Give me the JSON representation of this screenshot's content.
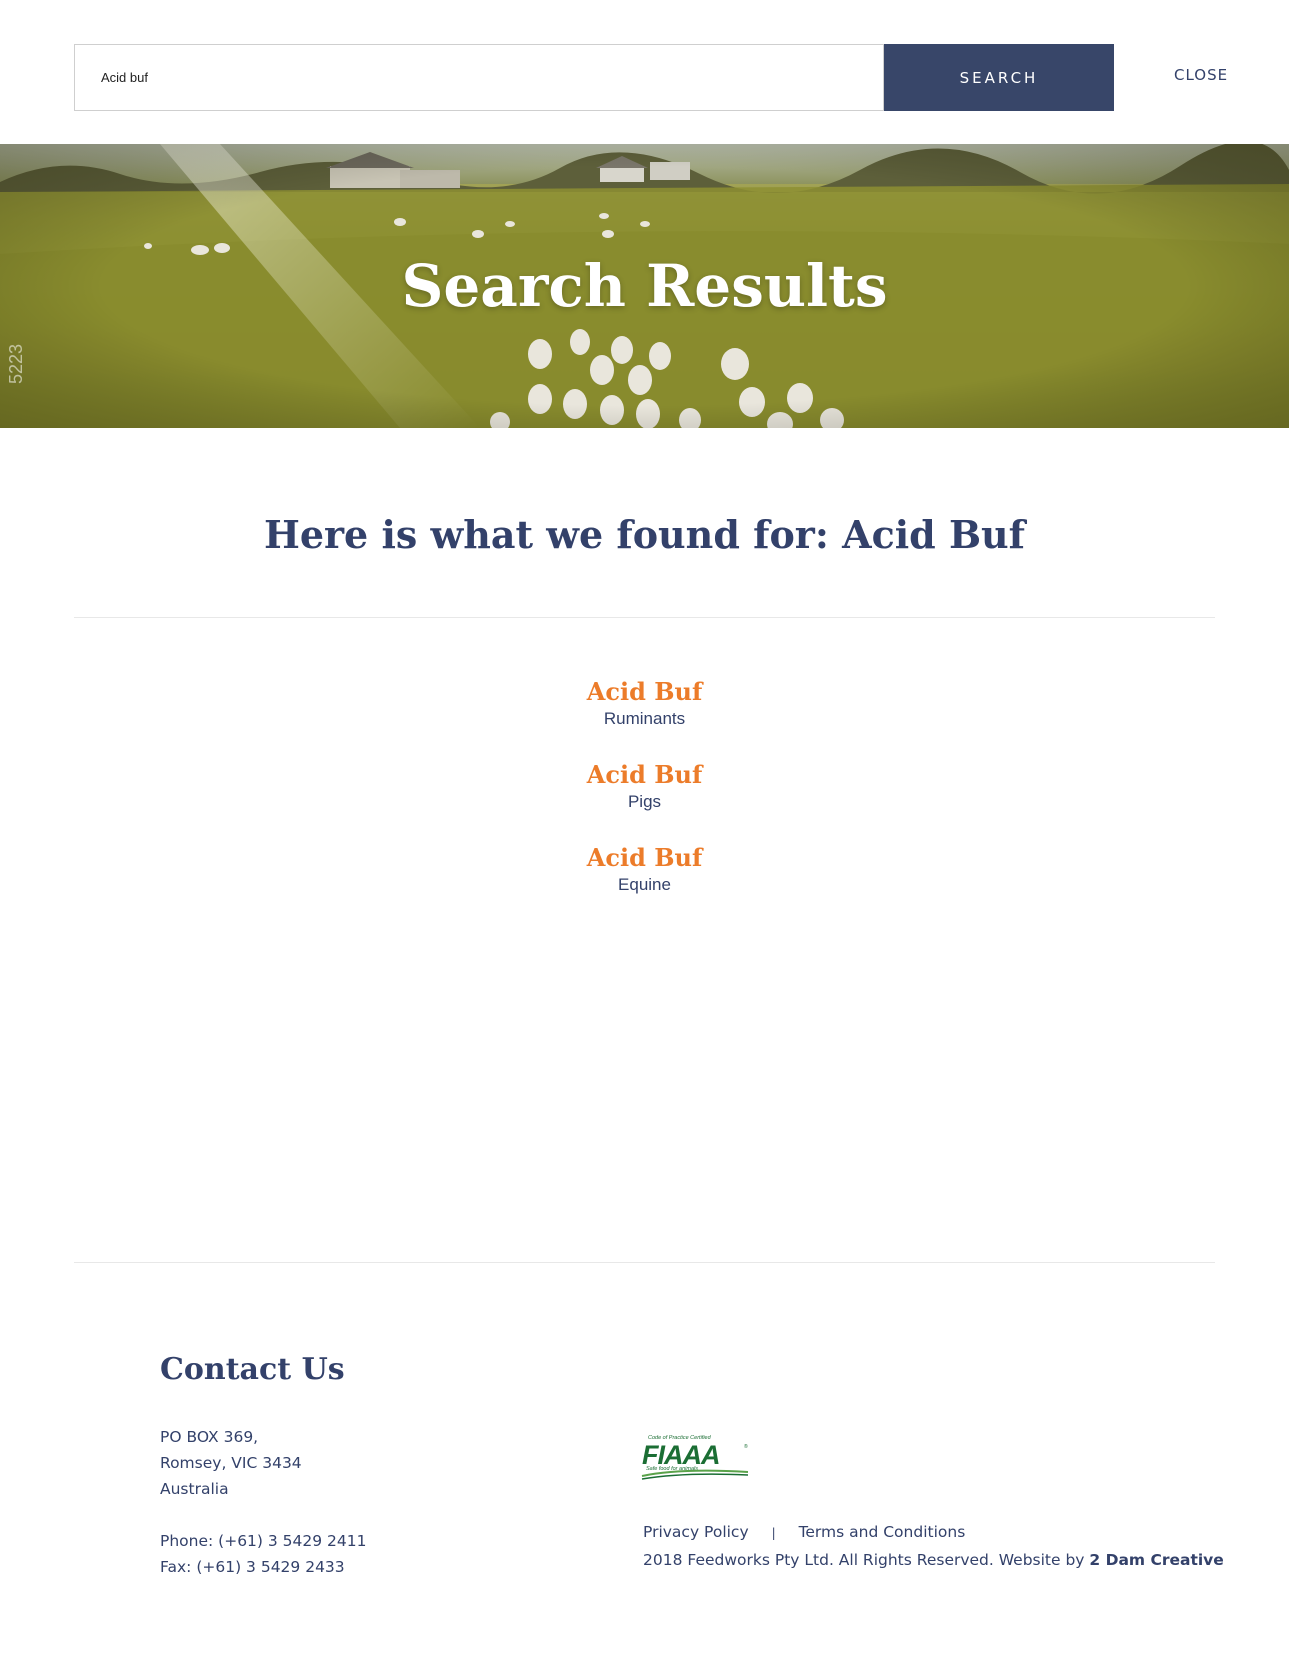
{
  "search": {
    "input_value": "Acid buf",
    "button_label": "SEARCH",
    "close_label": "CLOSE"
  },
  "hero": {
    "title": "Search Results",
    "photo_number": "5223"
  },
  "results": {
    "heading": "Here is what we found for: Acid Buf",
    "items": [
      {
        "title": "Acid Buf",
        "category": "Ruminants"
      },
      {
        "title": "Acid Buf",
        "category": "Pigs"
      },
      {
        "title": "Acid Buf",
        "category": "Equine"
      }
    ]
  },
  "footer": {
    "contact_title": "Contact Us",
    "address_lines": [
      "PO BOX 369,",
      "Romsey, VIC 3434",
      "Australia"
    ],
    "phone": "Phone: (+61) 3 5429 2411",
    "fax": "Fax: (+61) 3 5429 2433",
    "logo": {
      "name": "fiaaa-logo",
      "text": "FIAAA",
      "top_text": "Code of Practice Certified",
      "tagline": "Safe food for animals"
    },
    "privacy_label": "Privacy Policy",
    "separator": "|",
    "terms_label": "Terms and Conditions",
    "copyright_text": "2018 Feedworks Pty Ltd. All Rights Reserved. Website by ",
    "credit_label": "2 Dam Creative"
  },
  "colors": {
    "navy": "#384669",
    "text": "#33416a",
    "accent_orange": "#ec7c2a",
    "logo_green": "#1b6e34"
  }
}
